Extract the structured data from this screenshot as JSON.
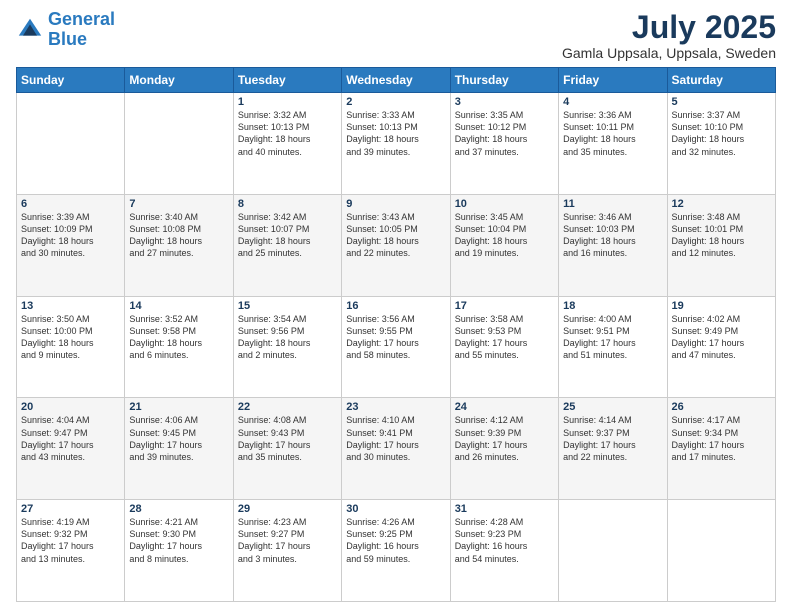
{
  "logo": {
    "line1": "General",
    "line2": "Blue"
  },
  "title": "July 2025",
  "subtitle": "Gamla Uppsala, Uppsala, Sweden",
  "weekdays": [
    "Sunday",
    "Monday",
    "Tuesday",
    "Wednesday",
    "Thursday",
    "Friday",
    "Saturday"
  ],
  "weeks": [
    [
      {
        "day": "",
        "info": ""
      },
      {
        "day": "",
        "info": ""
      },
      {
        "day": "1",
        "info": "Sunrise: 3:32 AM\nSunset: 10:13 PM\nDaylight: 18 hours\nand 40 minutes."
      },
      {
        "day": "2",
        "info": "Sunrise: 3:33 AM\nSunset: 10:13 PM\nDaylight: 18 hours\nand 39 minutes."
      },
      {
        "day": "3",
        "info": "Sunrise: 3:35 AM\nSunset: 10:12 PM\nDaylight: 18 hours\nand 37 minutes."
      },
      {
        "day": "4",
        "info": "Sunrise: 3:36 AM\nSunset: 10:11 PM\nDaylight: 18 hours\nand 35 minutes."
      },
      {
        "day": "5",
        "info": "Sunrise: 3:37 AM\nSunset: 10:10 PM\nDaylight: 18 hours\nand 32 minutes."
      }
    ],
    [
      {
        "day": "6",
        "info": "Sunrise: 3:39 AM\nSunset: 10:09 PM\nDaylight: 18 hours\nand 30 minutes."
      },
      {
        "day": "7",
        "info": "Sunrise: 3:40 AM\nSunset: 10:08 PM\nDaylight: 18 hours\nand 27 minutes."
      },
      {
        "day": "8",
        "info": "Sunrise: 3:42 AM\nSunset: 10:07 PM\nDaylight: 18 hours\nand 25 minutes."
      },
      {
        "day": "9",
        "info": "Sunrise: 3:43 AM\nSunset: 10:05 PM\nDaylight: 18 hours\nand 22 minutes."
      },
      {
        "day": "10",
        "info": "Sunrise: 3:45 AM\nSunset: 10:04 PM\nDaylight: 18 hours\nand 19 minutes."
      },
      {
        "day": "11",
        "info": "Sunrise: 3:46 AM\nSunset: 10:03 PM\nDaylight: 18 hours\nand 16 minutes."
      },
      {
        "day": "12",
        "info": "Sunrise: 3:48 AM\nSunset: 10:01 PM\nDaylight: 18 hours\nand 12 minutes."
      }
    ],
    [
      {
        "day": "13",
        "info": "Sunrise: 3:50 AM\nSunset: 10:00 PM\nDaylight: 18 hours\nand 9 minutes."
      },
      {
        "day": "14",
        "info": "Sunrise: 3:52 AM\nSunset: 9:58 PM\nDaylight: 18 hours\nand 6 minutes."
      },
      {
        "day": "15",
        "info": "Sunrise: 3:54 AM\nSunset: 9:56 PM\nDaylight: 18 hours\nand 2 minutes."
      },
      {
        "day": "16",
        "info": "Sunrise: 3:56 AM\nSunset: 9:55 PM\nDaylight: 17 hours\nand 58 minutes."
      },
      {
        "day": "17",
        "info": "Sunrise: 3:58 AM\nSunset: 9:53 PM\nDaylight: 17 hours\nand 55 minutes."
      },
      {
        "day": "18",
        "info": "Sunrise: 4:00 AM\nSunset: 9:51 PM\nDaylight: 17 hours\nand 51 minutes."
      },
      {
        "day": "19",
        "info": "Sunrise: 4:02 AM\nSunset: 9:49 PM\nDaylight: 17 hours\nand 47 minutes."
      }
    ],
    [
      {
        "day": "20",
        "info": "Sunrise: 4:04 AM\nSunset: 9:47 PM\nDaylight: 17 hours\nand 43 minutes."
      },
      {
        "day": "21",
        "info": "Sunrise: 4:06 AM\nSunset: 9:45 PM\nDaylight: 17 hours\nand 39 minutes."
      },
      {
        "day": "22",
        "info": "Sunrise: 4:08 AM\nSunset: 9:43 PM\nDaylight: 17 hours\nand 35 minutes."
      },
      {
        "day": "23",
        "info": "Sunrise: 4:10 AM\nSunset: 9:41 PM\nDaylight: 17 hours\nand 30 minutes."
      },
      {
        "day": "24",
        "info": "Sunrise: 4:12 AM\nSunset: 9:39 PM\nDaylight: 17 hours\nand 26 minutes."
      },
      {
        "day": "25",
        "info": "Sunrise: 4:14 AM\nSunset: 9:37 PM\nDaylight: 17 hours\nand 22 minutes."
      },
      {
        "day": "26",
        "info": "Sunrise: 4:17 AM\nSunset: 9:34 PM\nDaylight: 17 hours\nand 17 minutes."
      }
    ],
    [
      {
        "day": "27",
        "info": "Sunrise: 4:19 AM\nSunset: 9:32 PM\nDaylight: 17 hours\nand 13 minutes."
      },
      {
        "day": "28",
        "info": "Sunrise: 4:21 AM\nSunset: 9:30 PM\nDaylight: 17 hours\nand 8 minutes."
      },
      {
        "day": "29",
        "info": "Sunrise: 4:23 AM\nSunset: 9:27 PM\nDaylight: 17 hours\nand 3 minutes."
      },
      {
        "day": "30",
        "info": "Sunrise: 4:26 AM\nSunset: 9:25 PM\nDaylight: 16 hours\nand 59 minutes."
      },
      {
        "day": "31",
        "info": "Sunrise: 4:28 AM\nSunset: 9:23 PM\nDaylight: 16 hours\nand 54 minutes."
      },
      {
        "day": "",
        "info": ""
      },
      {
        "day": "",
        "info": ""
      }
    ]
  ]
}
